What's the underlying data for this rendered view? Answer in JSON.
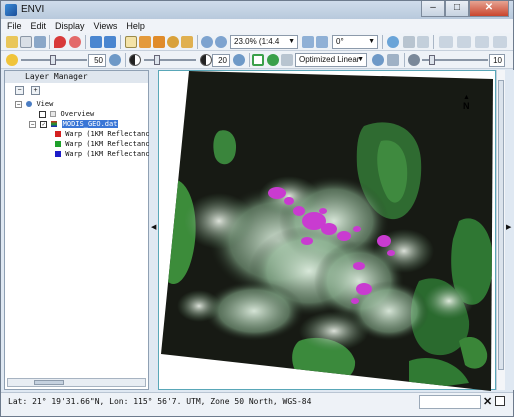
{
  "window": {
    "title": "ENVI",
    "minimize": "–",
    "maximize": "□",
    "close": "✕"
  },
  "menu": [
    "File",
    "Edit",
    "Display",
    "Views",
    "Help"
  ],
  "toolbar": {
    "zoom": "23.0% (1:4.4",
    "rotation": "0°",
    "brightness": "50",
    "contrast": "20",
    "stretch": "Optimized Linear",
    "sharpen": "10"
  },
  "layer_manager": {
    "title": "Layer Manager",
    "root": "View",
    "overview": "Overview",
    "file": "MODIS_GEO.dat",
    "bands": [
      {
        "label": "Warp (1KM Reflectance",
        "color": "#d42020"
      },
      {
        "label": "Warp (1KM Reflectance",
        "color": "#1ea02a"
      },
      {
        "label": "Warp (1KM Reflectance",
        "color": "#1c1cc8"
      }
    ]
  },
  "view": {
    "north": "N"
  },
  "status": "Lat: 21° 19'31.66\"N, Lon: 115° 56'7.  UTM, Zone 50 North, WGS-84",
  "colors": {
    "accent": "#3a76d6",
    "view_border": "#59a7b8"
  }
}
